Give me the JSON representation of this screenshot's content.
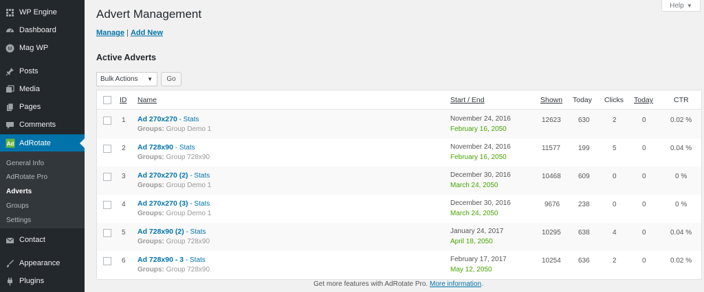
{
  "sidebar": {
    "items": [
      {
        "label": "WP Engine",
        "icon": "wp-engine-icon"
      },
      {
        "label": "Dashboard",
        "icon": "dashboard-icon"
      },
      {
        "label": "Mag WP",
        "icon": "magwp-icon"
      },
      {
        "label": "Posts",
        "icon": "pin-icon"
      },
      {
        "label": "Media",
        "icon": "media-icon"
      },
      {
        "label": "Pages",
        "icon": "pages-icon"
      },
      {
        "label": "Comments",
        "icon": "comments-icon"
      },
      {
        "label": "AdRotate",
        "icon": "adrotate-icon"
      },
      {
        "label": "Contact",
        "icon": "mail-icon"
      },
      {
        "label": "Appearance",
        "icon": "appearance-icon"
      },
      {
        "label": "Plugins",
        "icon": "plugins-icon"
      }
    ],
    "submenu": [
      "General Info",
      "AdRotate Pro",
      "Adverts",
      "Groups",
      "Settings"
    ],
    "active_color": "#0073aa"
  },
  "header": {
    "title": "Advert Management",
    "help_label": "Help",
    "subnav": {
      "manage": "Manage",
      "separator": " | ",
      "add_new": "Add New"
    }
  },
  "section_title": "Active Adverts",
  "bulk": {
    "label": "Bulk Actions",
    "go_label": "Go"
  },
  "table": {
    "columns": {
      "id": "ID",
      "name": "Name",
      "start_end": "Start / End",
      "shown": "Shown",
      "today": "Today",
      "clicks": "Clicks",
      "today_clicks": "Today",
      "ctr": "CTR"
    },
    "groups_label": "Groups:",
    "stats_label": "- Stats",
    "rows": [
      {
        "id": "1",
        "name": "Ad 270x270",
        "group": "Group Demo 1",
        "start": "November 24, 2016",
        "end": "February 16, 2050",
        "shown": "12623",
        "today": "630",
        "clicks": "2",
        "today_clicks": "0",
        "ctr": "0.02 %"
      },
      {
        "id": "2",
        "name": "Ad 728x90",
        "group": "Group 728x90",
        "start": "November 24, 2016",
        "end": "February 16, 2050",
        "shown": "11577",
        "today": "199",
        "clicks": "5",
        "today_clicks": "0",
        "ctr": "0.04 %"
      },
      {
        "id": "3",
        "name": "Ad 270x270 (2)",
        "group": "Group Demo 1",
        "start": "December 30, 2016",
        "end": "March 24, 2050",
        "shown": "10468",
        "today": "609",
        "clicks": "0",
        "today_clicks": "0",
        "ctr": "0 %"
      },
      {
        "id": "4",
        "name": "Ad 270x270 (3)",
        "group": "Group Demo 1",
        "start": "December 30, 2016",
        "end": "March 24, 2050",
        "shown": "9676",
        "today": "238",
        "clicks": "0",
        "today_clicks": "0",
        "ctr": "0 %"
      },
      {
        "id": "5",
        "name": "Ad 728x90 (2)",
        "group": "Group 728x90",
        "start": "January 24, 2017",
        "end": "April 18, 2050",
        "shown": "10295",
        "today": "638",
        "clicks": "4",
        "today_clicks": "0",
        "ctr": "0.04 %"
      },
      {
        "id": "6",
        "name": "Ad 728x90 - 3",
        "group": "Group 728x90",
        "start": "February 17, 2017",
        "end": "May 12, 2050",
        "shown": "10254",
        "today": "636",
        "clicks": "2",
        "today_clicks": "0",
        "ctr": "0.02 %"
      }
    ]
  },
  "footer": {
    "text": "Get more features with AdRotate Pro.",
    "link": "More information",
    "end": "."
  }
}
